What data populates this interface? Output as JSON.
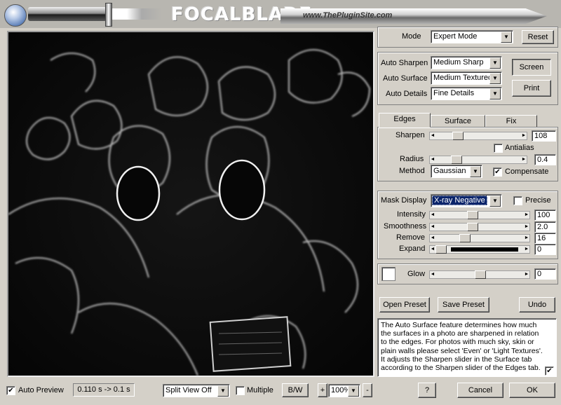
{
  "header": {
    "logo": "FOCALBLADE",
    "site": "www.ThePluginSite.com"
  },
  "mode": {
    "label": "Mode",
    "value": "Expert Mode",
    "reset": "Reset"
  },
  "auto": {
    "sharpen_label": "Auto Sharpen",
    "sharpen_value": "Medium Sharp",
    "surface_label": "Auto Surface",
    "surface_value": "Medium Textured",
    "details_label": "Auto Details",
    "details_value": "Fine Details",
    "screen": "Screen",
    "print": "Print"
  },
  "tabs": [
    "Edges",
    "Surface",
    "Fix"
  ],
  "edges": {
    "sharpen_label": "Sharpen",
    "sharpen_value": "108",
    "sharpen_level": 0.22,
    "antialias_label": "Antialias",
    "radius_label": "Radius",
    "radius_value": "0.4",
    "radius_level": 0.2,
    "method_label": "Method",
    "method_value": "Gaussian",
    "compensate_label": "Compensate"
  },
  "mask": {
    "display_label": "Mask Display",
    "display_value": "X-ray Negative",
    "precise_label": "Precise",
    "intensity_label": "Intensity",
    "intensity_value": "100",
    "intensity_level": 0.4,
    "smoothness_label": "Smoothness",
    "smoothness_value": "2.0",
    "smoothness_level": 0.4,
    "remove_label": "Remove",
    "remove_value": "16",
    "remove_level": 0.3,
    "expand_label": "Expand",
    "expand_value": "0",
    "expand_level": 0.0
  },
  "glow": {
    "label": "Glow",
    "value": "0",
    "level": 0.5
  },
  "presets": {
    "open": "Open Preset",
    "save": "Save Preset",
    "undo": "Undo"
  },
  "help_text": "The Auto Surface feature determines how much the surfaces in a photo are sharpened in relation to the edges. For photos with much sky, skin or plain walls please select 'Even' or 'Light Textures'. It adjusts the Sharpen slider in the Surface tab according to the Sharpen slider of the Edges tab.",
  "bottom": {
    "auto_preview": "Auto Preview",
    "timing": "0.110 s -> 0.1 s",
    "split_view": "Split View Off",
    "multiple": "Multiple",
    "bw": "B/W",
    "plus": "+",
    "zoom": "100%",
    "minus": "-",
    "help": "?",
    "cancel": "Cancel",
    "ok": "OK"
  }
}
